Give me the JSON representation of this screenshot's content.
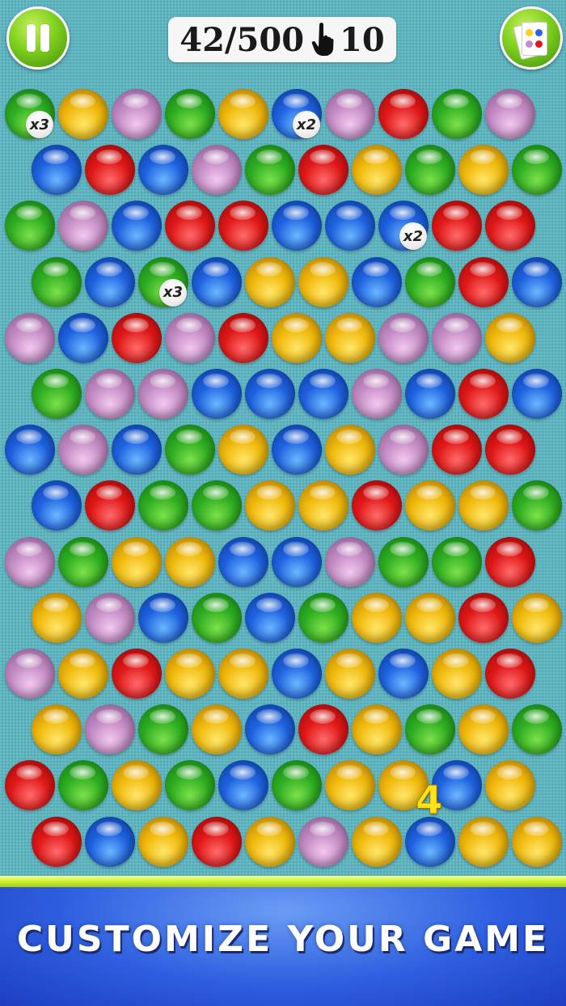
{
  "hud": {
    "pause_icon": "pause-icon",
    "score": "42/500",
    "moves_icon": "hand-pointer-icon",
    "moves": "10",
    "deck_icon": "card-colors-icon"
  },
  "board": {
    "colors": {
      "green": "#2fae22",
      "yellow": "#f0b90b",
      "purple": "#c48cc4",
      "red": "#e01818",
      "blue": "#1f62e0"
    },
    "rows": [
      [
        "green",
        "yellow",
        "purple",
        "green",
        "yellow",
        "blue",
        "purple",
        "red",
        "green",
        "purple"
      ],
      [
        "blue",
        "red",
        "blue",
        "purple",
        "green",
        "red",
        "yellow",
        "green",
        "yellow",
        "green"
      ],
      [
        "green",
        "purple",
        "blue",
        "red",
        "red",
        "blue",
        "blue",
        "blue",
        "red",
        "red"
      ],
      [
        "green",
        "blue",
        "green",
        "blue",
        "yellow",
        "yellow",
        "blue",
        "green",
        "red",
        "blue"
      ],
      [
        "purple",
        "blue",
        "red",
        "purple",
        "red",
        "yellow",
        "yellow",
        "purple",
        "purple",
        "yellow"
      ],
      [
        "green",
        "purple",
        "purple",
        "blue",
        "blue",
        "blue",
        "purple",
        "blue",
        "red",
        "blue"
      ],
      [
        "blue",
        "purple",
        "blue",
        "green",
        "yellow",
        "blue",
        "yellow",
        "purple",
        "red",
        "red"
      ],
      [
        "blue",
        "red",
        "green",
        "green",
        "yellow",
        "yellow",
        "red",
        "yellow",
        "yellow",
        "green"
      ],
      [
        "purple",
        "green",
        "yellow",
        "yellow",
        "blue",
        "blue",
        "purple",
        "green",
        "green",
        "red"
      ],
      [
        "yellow",
        "purple",
        "blue",
        "green",
        "blue",
        "green",
        "yellow",
        "yellow",
        "red",
        "yellow"
      ],
      [
        "purple",
        "yellow",
        "red",
        "yellow",
        "yellow",
        "blue",
        "yellow",
        "blue",
        "yellow",
        "red"
      ],
      [
        "yellow",
        "purple",
        "green",
        "yellow",
        "blue",
        "red",
        "yellow",
        "green",
        "yellow",
        "green"
      ],
      [
        "red",
        "green",
        "yellow",
        "green",
        "blue",
        "green",
        "yellow",
        "yellow",
        "blue",
        "yellow"
      ],
      [
        "red",
        "blue",
        "yellow",
        "red",
        "yellow",
        "purple",
        "yellow",
        "blue",
        "yellow",
        "yellow"
      ]
    ],
    "multipliers": [
      {
        "row": 0,
        "col": 0,
        "label": "x3"
      },
      {
        "row": 0,
        "col": 5,
        "label": "x2"
      },
      {
        "row": 2,
        "col": 7,
        "label": "x2"
      },
      {
        "row": 3,
        "col": 2,
        "label": "x3"
      }
    ],
    "combo_number": "4"
  },
  "banner": {
    "text": "CUSTOMIZE YOUR GAME"
  }
}
